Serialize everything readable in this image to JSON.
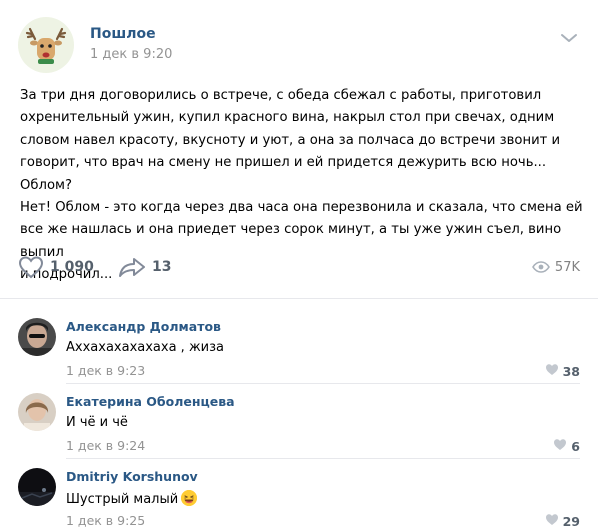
{
  "post": {
    "author": "Пошлое",
    "time": "1 дек в 9:20",
    "text": "За три дня договорились о встрече, с обеда сбежал с работы, приготовил\nохренительный ужин, купил красного вина, накрыл стол при свечах, одним\nсловом навел красоту, вкусноту и уют, а она за полчаса до встречи звонит и\nговорит, что врач на смену не пришел и ей придется дежурить всю ночь... Облом?\nНет! Облом - это когда через два часа она перезвонила и сказала, что смена ей\nвсе же нашлась и она приедет через сорок минут, а ты уже ужин съел, вино выпил\nи подрочил...",
    "likes": "1 090",
    "shares": "13",
    "views": "57K",
    "icons": {
      "avatar": "deer-avatar-icon",
      "more": "chevron-down-icon",
      "like": "heart-icon",
      "share": "share-arrow-icon",
      "views": "eye-icon"
    }
  },
  "comments": [
    {
      "author": "Александр Долматов",
      "text": "Аххахахахахаха , жиза",
      "time": "1 дек в 9:23",
      "likes": "38"
    },
    {
      "author": "Екатерина Оболенцева",
      "text": "И чё и чё",
      "time": "1 дек в 9:24",
      "likes": "6"
    },
    {
      "author": "Dmitriy Korshunov",
      "text": "Шустрый малый",
      "time": "1 дек в 9:25",
      "likes": "29",
      "emoji": "laughing-face-emoji"
    }
  ],
  "colors": {
    "link": "#2a5885",
    "meta": "#939393",
    "divider": "#e7e8ec"
  }
}
